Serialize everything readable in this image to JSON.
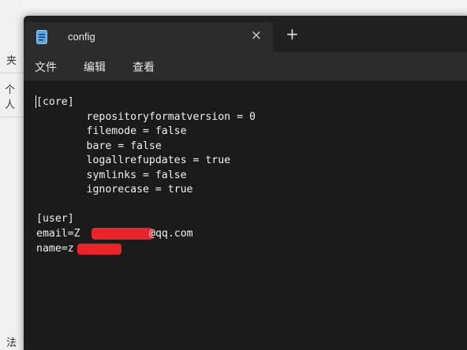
{
  "background_app": {
    "labels": [
      "夹",
      "个人",
      "法"
    ]
  },
  "tab": {
    "title": "config",
    "icon": "notepad-icon",
    "close_icon": "×",
    "new_tab_icon": "+"
  },
  "menu": {
    "items": [
      "文件",
      "编辑",
      "查看"
    ]
  },
  "document": {
    "lines": [
      "[core]",
      "        repositoryformatversion = 0",
      "        filemode = false",
      "        bare = false",
      "        logallrefupdates = true",
      "        symlinks = false",
      "        ignorecase = true",
      "",
      "[user]",
      "email=Z",
      "name=z"
    ],
    "email_suffix": "@qq.com"
  },
  "colors": {
    "redaction": "#e8232a",
    "editor_bg": "#1b1b1b",
    "menubar_bg": "#2c2c2c"
  }
}
